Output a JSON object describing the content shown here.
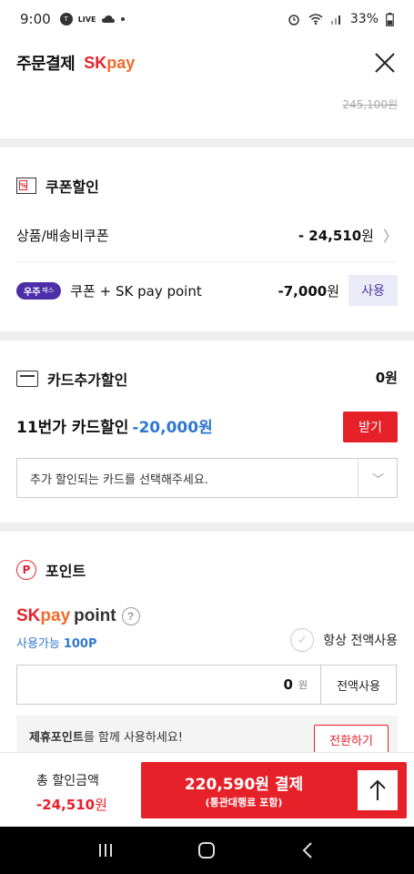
{
  "status_bar": {
    "time": "9:00",
    "app_chip": "TALK",
    "app_chip2": "LIVE",
    "battery": "33%"
  },
  "header": {
    "title": "주문결제",
    "brand_sk": "SK",
    "brand_pay": "pay"
  },
  "clipped_prev": {
    "original_price": "245,100원"
  },
  "coupon": {
    "title": "쿠폰할인",
    "product_label": "상품/배송비쿠폰",
    "product_value": "- 24,510",
    "product_unit": "원",
    "woojoo_badge": "우주",
    "woojoo_small": "패스",
    "sk_label": "쿠폰 + SK pay point",
    "sk_value": "-7,000",
    "sk_unit": "원",
    "use_button": "사용"
  },
  "card": {
    "title": "카드추가할인",
    "value": "0원",
    "discount_label": "11번가 카드할인",
    "discount_amount": "-20,000원",
    "receive_button": "받기",
    "select_placeholder": "추가 할인되는 카드를 선택해주세요."
  },
  "point": {
    "title": "포인트",
    "logo_sk": "SK",
    "logo_pay": "pay",
    "logo_point": "point",
    "available_label": "사용가능",
    "available_value": "100P",
    "always_label": "항상 전액사용",
    "input_value": "0",
    "input_unit": "원",
    "all_button": "전액사용",
    "partner_bold": "제휴포인트",
    "partner_rest": "를 함께 사용하세요!",
    "convert_button": "전환하기"
  },
  "bottom": {
    "total_label": "총 할인금액",
    "total_value": "-24,510",
    "total_unit": "원",
    "pay_main": "220,590원 결제",
    "pay_sub": "(통관대행료 포함)"
  },
  "colors": {
    "accent_red": "#e6212a",
    "accent_blue": "#2f78d0",
    "woojoo_purple": "#4b2ea8"
  }
}
